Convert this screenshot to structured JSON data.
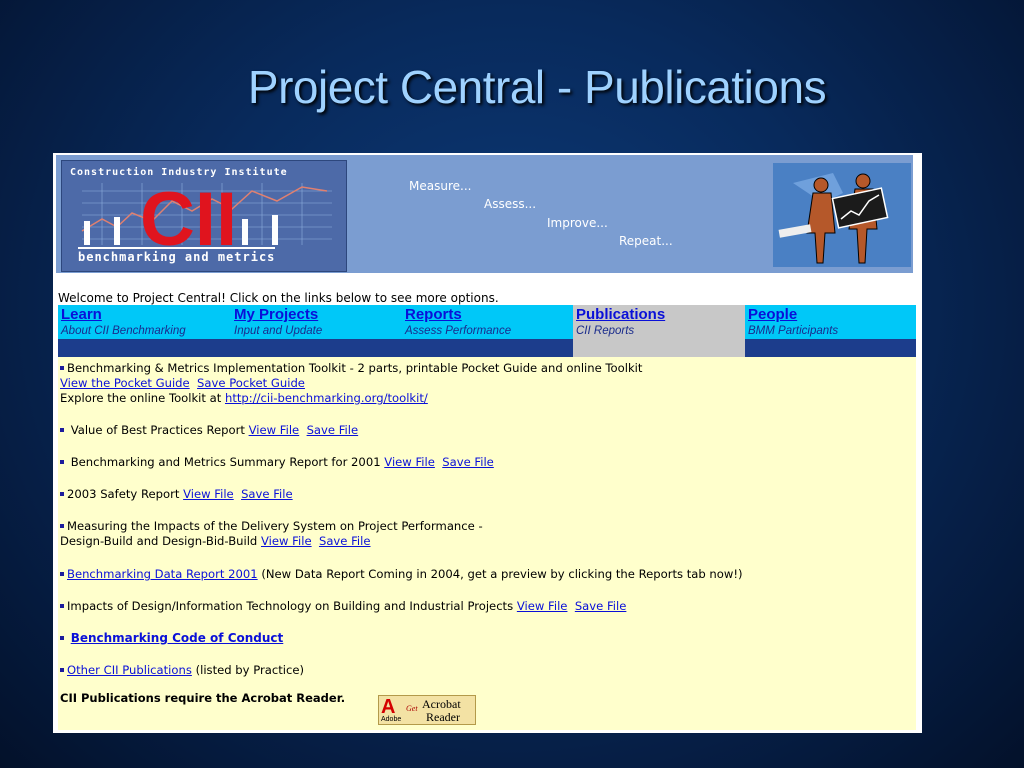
{
  "slide": {
    "title": "Project Central - Publications"
  },
  "banner": {
    "logo_top": "Construction Industry Institute",
    "logo_mark": "CII",
    "logo_bottom": "benchmarking and metrics",
    "taglines": [
      "Measure...",
      "Assess...",
      "Improve...",
      "Repeat..."
    ]
  },
  "welcome": "Welcome to Project Central! Click on the links below to see more options.",
  "tabs": [
    {
      "title": "Learn",
      "sub": "About CII Benchmarking",
      "active": false
    },
    {
      "title": "My Projects",
      "sub": "Input and Update",
      "active": false
    },
    {
      "title": "Reports",
      "sub": "Assess Performance",
      "active": false
    },
    {
      "title": "Publications",
      "sub": "CII Reports",
      "active": true
    },
    {
      "title": "People",
      "sub": "BMM Participants",
      "active": false
    }
  ],
  "content": {
    "toolkit": {
      "text": "Benchmarking & Metrics Implementation Toolkit - 2 parts, printable Pocket Guide and online Toolkit",
      "view_pocket": "View the Pocket Guide",
      "save_pocket": "Save Pocket Guide",
      "explore": "Explore the online Toolkit at ",
      "toolkit_url": "http://cii-benchmarking.org/toolkit/"
    },
    "best_practices": {
      "text": "Value of Best Practices Report",
      "view": "View File",
      "save": "Save File"
    },
    "summary_2001": {
      "text": "Benchmarking and Metrics Summary Report for 2001",
      "view": "View File",
      "save": "Save File"
    },
    "safety_2003": {
      "text": "2003 Safety Report",
      "view": "View File",
      "save": "Save File"
    },
    "delivery": {
      "text1": "Measuring the Impacts of the Delivery System on Project Performance -",
      "text2": "Design-Build and Design-Bid-Build",
      "view": "View File",
      "save": "Save File"
    },
    "data_report": {
      "link": "Benchmarking Data Report 2001",
      "text": " (New Data Report Coming in 2004, get a preview by clicking the Reports tab now!)"
    },
    "design_it": {
      "text": "Impacts of Design/Information Technology on Building and Industrial Projects",
      "view": "View File",
      "save": "Save File"
    },
    "code_of_conduct": {
      "link": "Benchmarking Code of Conduct"
    },
    "other": {
      "link": "Other CII Publications",
      "text": " (listed by Practice)"
    },
    "acrobat_note": "CII Publications require the Acrobat Reader.",
    "acrobat_badge": {
      "adobe": "Adobe",
      "get": "Get",
      "acrobat": "Acrobat",
      "reader": "Reader"
    }
  },
  "colors": {
    "tab_bg": "#00c8f8",
    "tab_active": "#c8c8c8",
    "content_bg": "#ffffcc",
    "link": "#0a10d8",
    "banner_bg": "#7b9dd1"
  }
}
